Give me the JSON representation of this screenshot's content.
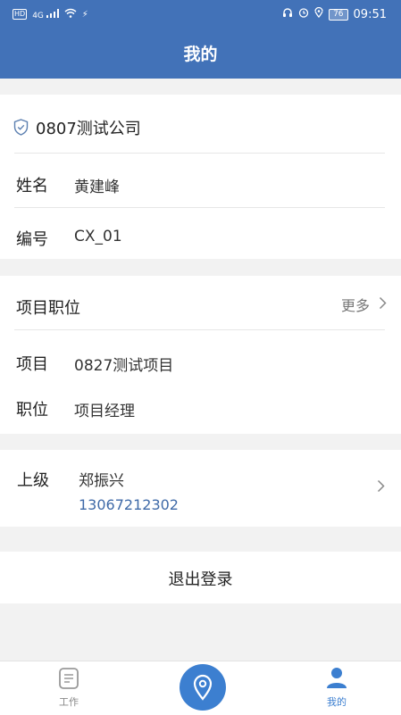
{
  "status_bar": {
    "network_badge": "HD",
    "signal_label": "4G",
    "battery_level": "76",
    "time": "09:51"
  },
  "header": {
    "title": "我的"
  },
  "company": {
    "name": "0807测试公司"
  },
  "profile": {
    "name_label": "姓名",
    "name_value": "黄建峰",
    "id_label": "编号",
    "id_value": "CX_01"
  },
  "project_position": {
    "title": "项目职位",
    "more_label": "更多",
    "project_label": "项目",
    "project_value": "0827测试项目",
    "position_label": "职位",
    "position_value": "项目经理"
  },
  "superior": {
    "label": "上级",
    "name": "郑振兴",
    "phone": "13067212302"
  },
  "logout": {
    "label": "退出登录"
  },
  "tabbar": {
    "work_label": "工作",
    "mine_label": "我的"
  },
  "colors": {
    "brand": "#4272b8",
    "accent": "#3c7fd0",
    "phone": "#3f6aa8"
  }
}
